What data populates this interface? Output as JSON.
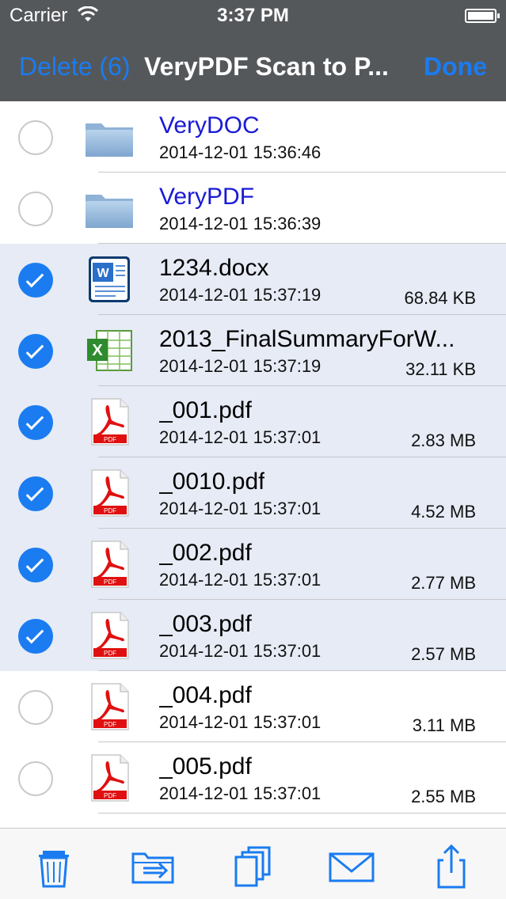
{
  "status": {
    "carrier": "Carrier",
    "time": "3:37 PM"
  },
  "nav": {
    "left": "Delete (6)",
    "title": "VeryPDF Scan to P...",
    "right": "Done"
  },
  "colors": {
    "accent": "#1a7cf0",
    "folder_text": "#1a1ad6",
    "bar": "#55585b",
    "selected_row": "#e6ebf5"
  },
  "rows": [
    {
      "name": "VeryDOC",
      "date": "2014-12-01 15:36:46",
      "size": "",
      "kind": "folder",
      "selected": false
    },
    {
      "name": "VeryPDF",
      "date": "2014-12-01 15:36:39",
      "size": "",
      "kind": "folder",
      "selected": false
    },
    {
      "name": "1234.docx",
      "date": "2014-12-01 15:37:19",
      "size": "68.84 KB",
      "kind": "word",
      "selected": true
    },
    {
      "name": "2013_FinalSummaryForW...",
      "date": "2014-12-01 15:37:19",
      "size": "32.11 KB",
      "kind": "excel",
      "selected": true
    },
    {
      "name": "_001.pdf",
      "date": "2014-12-01 15:37:01",
      "size": "2.83 MB",
      "kind": "pdf",
      "selected": true
    },
    {
      "name": "_0010.pdf",
      "date": "2014-12-01 15:37:01",
      "size": "4.52 MB",
      "kind": "pdf",
      "selected": true
    },
    {
      "name": "_002.pdf",
      "date": "2014-12-01 15:37:01",
      "size": "2.77 MB",
      "kind": "pdf",
      "selected": true
    },
    {
      "name": "_003.pdf",
      "date": "2014-12-01 15:37:01",
      "size": "2.57 MB",
      "kind": "pdf",
      "selected": true
    },
    {
      "name": "_004.pdf",
      "date": "2014-12-01 15:37:01",
      "size": "3.11 MB",
      "kind": "pdf",
      "selected": false
    },
    {
      "name": "_005.pdf",
      "date": "2014-12-01 15:37:01",
      "size": "2.55 MB",
      "kind": "pdf",
      "selected": false
    }
  ],
  "toolbar": {
    "icons": [
      "trash-icon",
      "move-to-folder-icon",
      "copy-icon",
      "mail-icon",
      "share-icon"
    ]
  },
  "icon_labels": {
    "pdf": "PDF",
    "word": "W"
  }
}
